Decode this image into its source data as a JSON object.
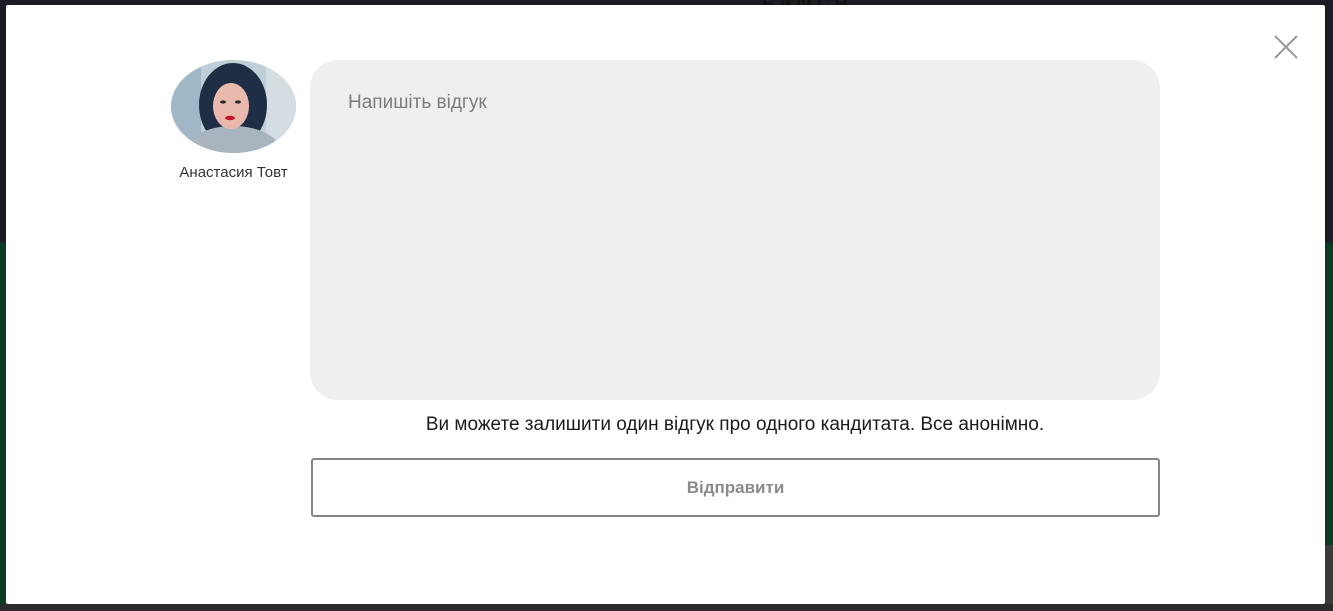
{
  "background": {
    "heading_fragment": "Б                    й   ій  С     Н"
  },
  "modal": {
    "close_icon": "close-icon",
    "author": {
      "name": "Анастасия Товт",
      "avatar_icon": "user-avatar"
    },
    "review": {
      "placeholder": "Напишіть відгук",
      "value": ""
    },
    "notice": "Ви можете залишити один відгук про одного кандитата. Все анонімно.",
    "submit_label": "Відправити"
  },
  "colors": {
    "overlay_top": "#1c1d24",
    "overlay_bottom": "#0d3a22",
    "textarea_bg": "#efefef",
    "button_border": "#858585",
    "button_text": "#8a8a8a"
  }
}
